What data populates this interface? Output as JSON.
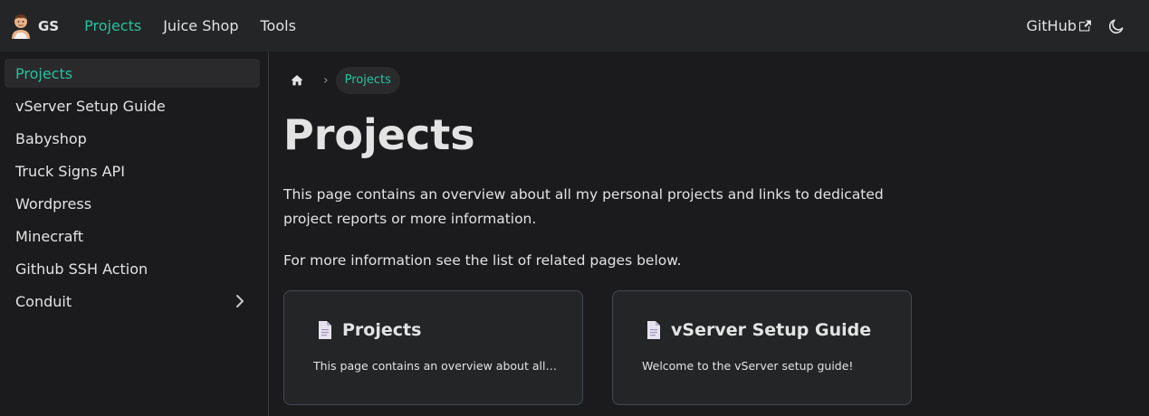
{
  "navbar": {
    "brand_title": "GS",
    "links": [
      "Projects",
      "Juice Shop",
      "Tools"
    ],
    "github_label": "GitHub",
    "accent_color": "#25c2a0"
  },
  "sidebar": {
    "items": [
      {
        "label": "Projects",
        "active": true
      },
      {
        "label": "vServer Setup Guide"
      },
      {
        "label": "Babyshop"
      },
      {
        "label": "Truck Signs API"
      },
      {
        "label": "Wordpress"
      },
      {
        "label": "Minecraft"
      },
      {
        "label": "Github SSH Action"
      },
      {
        "label": "Conduit",
        "expandable": true
      }
    ]
  },
  "breadcrumb": {
    "home_icon": "home-icon",
    "current": "Projects"
  },
  "main": {
    "title": "Projects",
    "paragraph1": "This page contains an overview about all my personal projects and links to dedicated project reports or more information.",
    "paragraph2": "For more information see the list of related pages below.",
    "cards": [
      {
        "title": "Projects",
        "description": "This page contains an overview about all my personal projects and links to dedicated project reports or more information.",
        "icon": "document-icon"
      },
      {
        "title": "vServer Setup Guide",
        "description": "Welcome to the vServer setup guide!",
        "icon": "document-icon"
      }
    ]
  }
}
